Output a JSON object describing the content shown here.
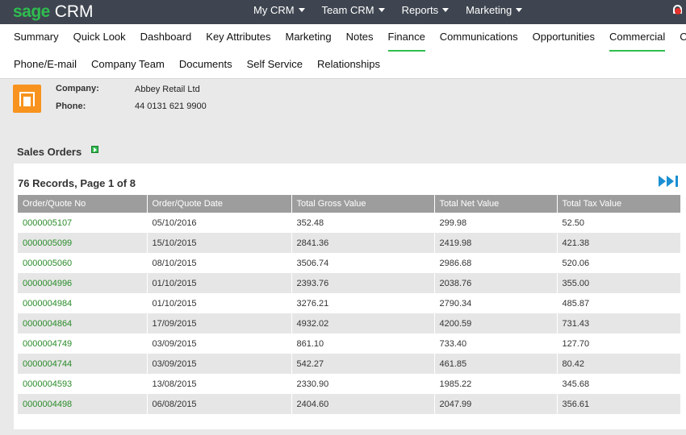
{
  "app": {
    "logo_sage": "sage",
    "logo_crm": "CRM"
  },
  "topmenu": [
    {
      "label": "My CRM"
    },
    {
      "label": "Team CRM"
    },
    {
      "label": "Reports"
    },
    {
      "label": "Marketing"
    }
  ],
  "tabs_row1": [
    {
      "label": "Summary",
      "active": false
    },
    {
      "label": "Quick Look",
      "active": false
    },
    {
      "label": "Dashboard",
      "active": false
    },
    {
      "label": "Key Attributes",
      "active": false
    },
    {
      "label": "Marketing",
      "active": false
    },
    {
      "label": "Notes",
      "active": false
    },
    {
      "label": "Finance",
      "active": true
    },
    {
      "label": "Communications",
      "active": false
    },
    {
      "label": "Opportunities",
      "active": false
    },
    {
      "label": "Commercial",
      "active": true
    },
    {
      "label": "Cases",
      "active": false
    }
  ],
  "tabs_row2": [
    {
      "label": "Phone/E-mail"
    },
    {
      "label": "Company Team"
    },
    {
      "label": "Documents"
    },
    {
      "label": "Self Service"
    },
    {
      "label": "Relationships"
    }
  ],
  "company": {
    "company_label": "Company:",
    "company_value": "Abbey Retail Ltd",
    "phone_label": "Phone:",
    "phone_value": "44 0131 621 9900"
  },
  "sales_orders": {
    "title": "Sales Orders",
    "records_text": "76 Records, Page 1 of 8",
    "columns": [
      "Order/Quote No",
      "Order/Quote Date",
      "Total Gross Value",
      "Total Net Value",
      "Total Tax Value"
    ],
    "rows": [
      [
        "0000005107",
        "05/10/2016",
        "352.48",
        "299.98",
        "52.50"
      ],
      [
        "0000005099",
        "15/10/2015",
        "2841.36",
        "2419.98",
        "421.38"
      ],
      [
        "0000005060",
        "08/10/2015",
        "3506.74",
        "2986.68",
        "520.06"
      ],
      [
        "0000004996",
        "01/10/2015",
        "2393.76",
        "2038.76",
        "355.00"
      ],
      [
        "0000004984",
        "01/10/2015",
        "3276.21",
        "2790.34",
        "485.87"
      ],
      [
        "0000004864",
        "17/09/2015",
        "4932.02",
        "4200.59",
        "731.43"
      ],
      [
        "0000004749",
        "03/09/2015",
        "861.10",
        "733.40",
        "127.70"
      ],
      [
        "0000004744",
        "03/09/2015",
        "542.27",
        "461.85",
        "80.42"
      ],
      [
        "0000004593",
        "13/08/2015",
        "2330.90",
        "1985.22",
        "345.68"
      ],
      [
        "0000004498",
        "06/08/2015",
        "2404.60",
        "2047.99",
        "356.61"
      ]
    ]
  },
  "colors": {
    "accent": "#2fbd4f",
    "topbar": "#3e4550",
    "company_icon": "#f7931e",
    "link": "#2a8c2a",
    "pager": "#1b8fd2"
  },
  "icons": {
    "company": "building-icon",
    "section": "flag-icon",
    "pager": "last-page-icon",
    "notifications": "bell-icon"
  }
}
